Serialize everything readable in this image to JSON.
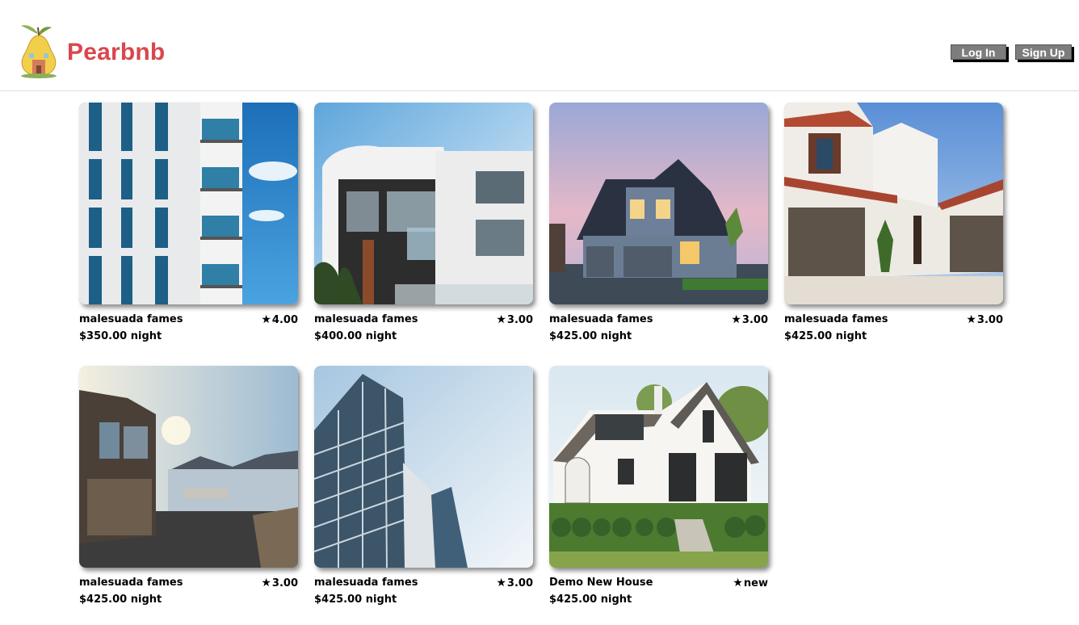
{
  "header": {
    "brand": "Pearbnb",
    "login_label": "Log In",
    "signup_label": "Sign Up",
    "brand_color": "#d8474d"
  },
  "listings": [
    {
      "title": "malesuada fames",
      "rating": "4.00",
      "price": "$350.00 night",
      "image": "white-apartment-tower"
    },
    {
      "title": "malesuada fames",
      "rating": "3.00",
      "price": "$400.00 night",
      "image": "modern-glass-house"
    },
    {
      "title": "malesuada fames",
      "rating": "3.00",
      "price": "$425.00 night",
      "image": "suburban-house-dusk"
    },
    {
      "title": "malesuada fames",
      "rating": "3.00",
      "price": "$425.00 night",
      "image": "stucco-villa"
    },
    {
      "title": "malesuada fames",
      "rating": "3.00",
      "price": "$425.00 night",
      "image": "stone-house-lake"
    },
    {
      "title": "malesuada fames",
      "rating": "3.00",
      "price": "$425.00 night",
      "image": "glass-skyscraper"
    },
    {
      "title": "Demo New House",
      "rating": "new",
      "price": "$425.00 night",
      "image": "white-cottage"
    }
  ]
}
